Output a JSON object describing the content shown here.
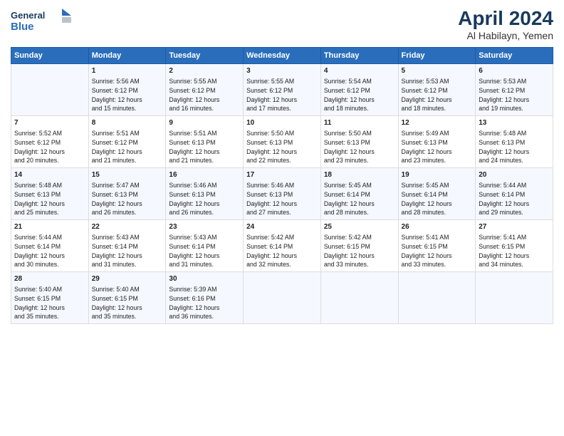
{
  "header": {
    "logo_line1": "General",
    "logo_line2": "Blue",
    "title": "April 2024",
    "subtitle": "Al Habilayn, Yemen"
  },
  "columns": [
    "Sunday",
    "Monday",
    "Tuesday",
    "Wednesday",
    "Thursday",
    "Friday",
    "Saturday"
  ],
  "weeks": [
    {
      "days": [
        {
          "num": "",
          "text": ""
        },
        {
          "num": "1",
          "text": "Sunrise: 5:56 AM\nSunset: 6:12 PM\nDaylight: 12 hours\nand 15 minutes."
        },
        {
          "num": "2",
          "text": "Sunrise: 5:55 AM\nSunset: 6:12 PM\nDaylight: 12 hours\nand 16 minutes."
        },
        {
          "num": "3",
          "text": "Sunrise: 5:55 AM\nSunset: 6:12 PM\nDaylight: 12 hours\nand 17 minutes."
        },
        {
          "num": "4",
          "text": "Sunrise: 5:54 AM\nSunset: 6:12 PM\nDaylight: 12 hours\nand 18 minutes."
        },
        {
          "num": "5",
          "text": "Sunrise: 5:53 AM\nSunset: 6:12 PM\nDaylight: 12 hours\nand 18 minutes."
        },
        {
          "num": "6",
          "text": "Sunrise: 5:53 AM\nSunset: 6:12 PM\nDaylight: 12 hours\nand 19 minutes."
        }
      ]
    },
    {
      "days": [
        {
          "num": "7",
          "text": "Sunrise: 5:52 AM\nSunset: 6:12 PM\nDaylight: 12 hours\nand 20 minutes."
        },
        {
          "num": "8",
          "text": "Sunrise: 5:51 AM\nSunset: 6:12 PM\nDaylight: 12 hours\nand 21 minutes."
        },
        {
          "num": "9",
          "text": "Sunrise: 5:51 AM\nSunset: 6:13 PM\nDaylight: 12 hours\nand 21 minutes."
        },
        {
          "num": "10",
          "text": "Sunrise: 5:50 AM\nSunset: 6:13 PM\nDaylight: 12 hours\nand 22 minutes."
        },
        {
          "num": "11",
          "text": "Sunrise: 5:50 AM\nSunset: 6:13 PM\nDaylight: 12 hours\nand 23 minutes."
        },
        {
          "num": "12",
          "text": "Sunrise: 5:49 AM\nSunset: 6:13 PM\nDaylight: 12 hours\nand 23 minutes."
        },
        {
          "num": "13",
          "text": "Sunrise: 5:48 AM\nSunset: 6:13 PM\nDaylight: 12 hours\nand 24 minutes."
        }
      ]
    },
    {
      "days": [
        {
          "num": "14",
          "text": "Sunrise: 5:48 AM\nSunset: 6:13 PM\nDaylight: 12 hours\nand 25 minutes."
        },
        {
          "num": "15",
          "text": "Sunrise: 5:47 AM\nSunset: 6:13 PM\nDaylight: 12 hours\nand 26 minutes."
        },
        {
          "num": "16",
          "text": "Sunrise: 5:46 AM\nSunset: 6:13 PM\nDaylight: 12 hours\nand 26 minutes."
        },
        {
          "num": "17",
          "text": "Sunrise: 5:46 AM\nSunset: 6:13 PM\nDaylight: 12 hours\nand 27 minutes."
        },
        {
          "num": "18",
          "text": "Sunrise: 5:45 AM\nSunset: 6:14 PM\nDaylight: 12 hours\nand 28 minutes."
        },
        {
          "num": "19",
          "text": "Sunrise: 5:45 AM\nSunset: 6:14 PM\nDaylight: 12 hours\nand 28 minutes."
        },
        {
          "num": "20",
          "text": "Sunrise: 5:44 AM\nSunset: 6:14 PM\nDaylight: 12 hours\nand 29 minutes."
        }
      ]
    },
    {
      "days": [
        {
          "num": "21",
          "text": "Sunrise: 5:44 AM\nSunset: 6:14 PM\nDaylight: 12 hours\nand 30 minutes."
        },
        {
          "num": "22",
          "text": "Sunrise: 5:43 AM\nSunset: 6:14 PM\nDaylight: 12 hours\nand 31 minutes."
        },
        {
          "num": "23",
          "text": "Sunrise: 5:43 AM\nSunset: 6:14 PM\nDaylight: 12 hours\nand 31 minutes."
        },
        {
          "num": "24",
          "text": "Sunrise: 5:42 AM\nSunset: 6:14 PM\nDaylight: 12 hours\nand 32 minutes."
        },
        {
          "num": "25",
          "text": "Sunrise: 5:42 AM\nSunset: 6:15 PM\nDaylight: 12 hours\nand 33 minutes."
        },
        {
          "num": "26",
          "text": "Sunrise: 5:41 AM\nSunset: 6:15 PM\nDaylight: 12 hours\nand 33 minutes."
        },
        {
          "num": "27",
          "text": "Sunrise: 5:41 AM\nSunset: 6:15 PM\nDaylight: 12 hours\nand 34 minutes."
        }
      ]
    },
    {
      "days": [
        {
          "num": "28",
          "text": "Sunrise: 5:40 AM\nSunset: 6:15 PM\nDaylight: 12 hours\nand 35 minutes."
        },
        {
          "num": "29",
          "text": "Sunrise: 5:40 AM\nSunset: 6:15 PM\nDaylight: 12 hours\nand 35 minutes."
        },
        {
          "num": "30",
          "text": "Sunrise: 5:39 AM\nSunset: 6:16 PM\nDaylight: 12 hours\nand 36 minutes."
        },
        {
          "num": "",
          "text": ""
        },
        {
          "num": "",
          "text": ""
        },
        {
          "num": "",
          "text": ""
        },
        {
          "num": "",
          "text": ""
        }
      ]
    }
  ]
}
